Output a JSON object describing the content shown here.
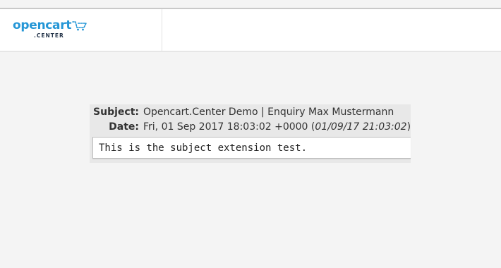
{
  "header": {
    "logo_word": "opencart",
    "logo_sub": ".CENTER"
  },
  "email": {
    "subject_label": "Subject:",
    "subject_value": "Opencart.Center Demo | Enquiry Max Mustermann",
    "date_label": "Date:",
    "date_value": "Fri, 01 Sep 2017 18:03:02 +0000",
    "date_local": "01/09/17 21:03:02",
    "body": "This is the subject extension test."
  },
  "colors": {
    "brand_blue": "#2496d6",
    "brand_dark": "#25354a"
  },
  "icons": {
    "logo_cart": "cart-icon"
  }
}
